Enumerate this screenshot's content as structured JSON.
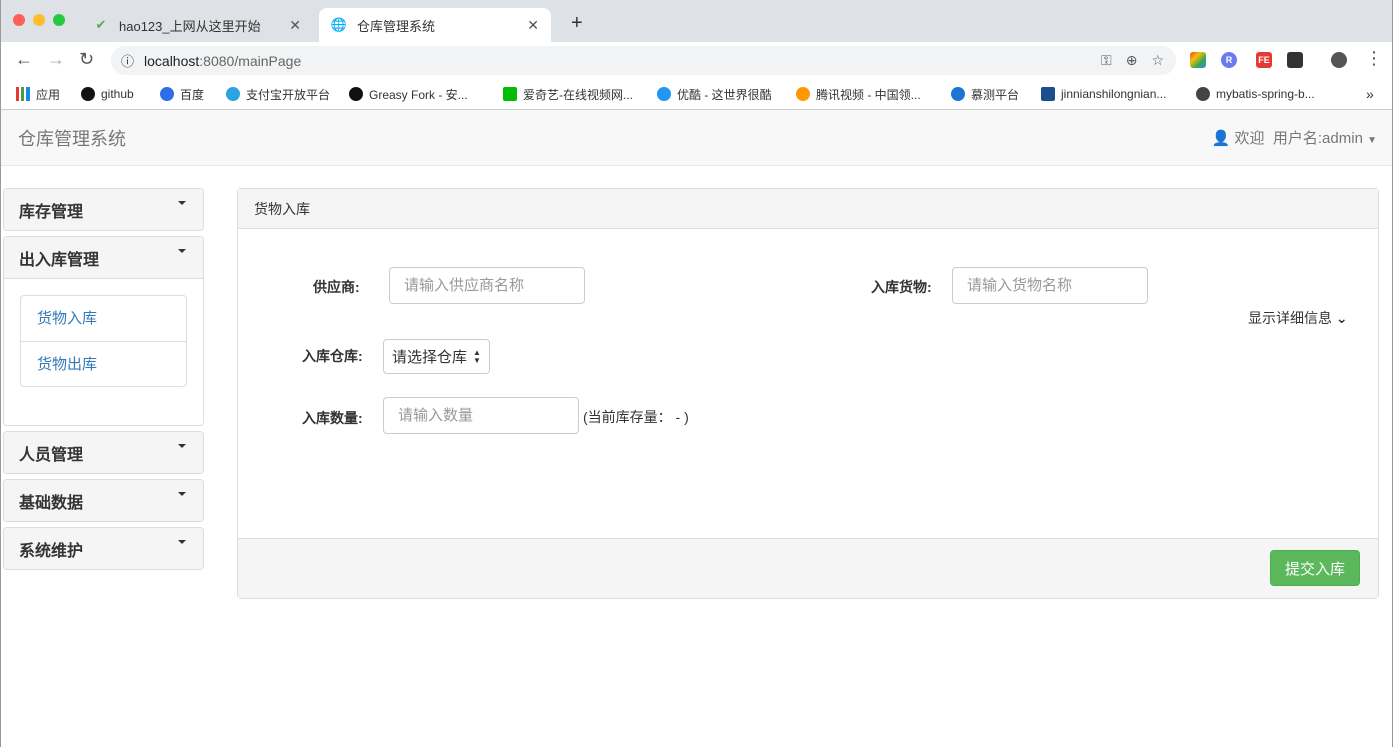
{
  "browser": {
    "tabs": [
      {
        "title": "hao123_上网从这里开始",
        "icon": "hao123-icon"
      },
      {
        "title": "仓库管理系统",
        "icon": "globe-icon",
        "active": true
      }
    ],
    "url_host": "localhost",
    "url_rest": ":8080/mainPage",
    "bookmarks": [
      "应用",
      "github",
      "百度",
      "支付宝开放平台",
      "Greasy Fork - 安...",
      "爱奇艺-在线视频网...",
      "优酷 - 这世界很酷",
      "腾讯视频 - 中国领...",
      "慕测平台",
      "jinnianshilongnian...",
      "mybatis-spring-b..."
    ],
    "bookmark_more": "»"
  },
  "app": {
    "brand": "仓库管理系统",
    "welcome": "欢迎",
    "username": "用户名:admin"
  },
  "sidebar": {
    "panels": [
      {
        "title": "库存管理"
      },
      {
        "title": "出入库管理",
        "items": [
          "货物入库",
          "货物出库"
        ]
      },
      {
        "title": "人员管理"
      },
      {
        "title": "基础数据"
      },
      {
        "title": "系统维护"
      }
    ]
  },
  "main": {
    "title": "货物入库",
    "supplier_label": "供应商:",
    "supplier_placeholder": "请输入供应商名称",
    "goods_label": "入库货物:",
    "goods_placeholder": "请输入货物名称",
    "detail_toggle": "显示详细信息",
    "warehouse_label": "入库仓库:",
    "warehouse_value": "请选择仓库",
    "quantity_label": "入库数量:",
    "quantity_placeholder": "请输入数量",
    "stock_info": "(当前库存量： - )",
    "submit": "提交入库"
  },
  "colors": {
    "primary_link": "#337ab7",
    "submit": "#5cb85c"
  }
}
